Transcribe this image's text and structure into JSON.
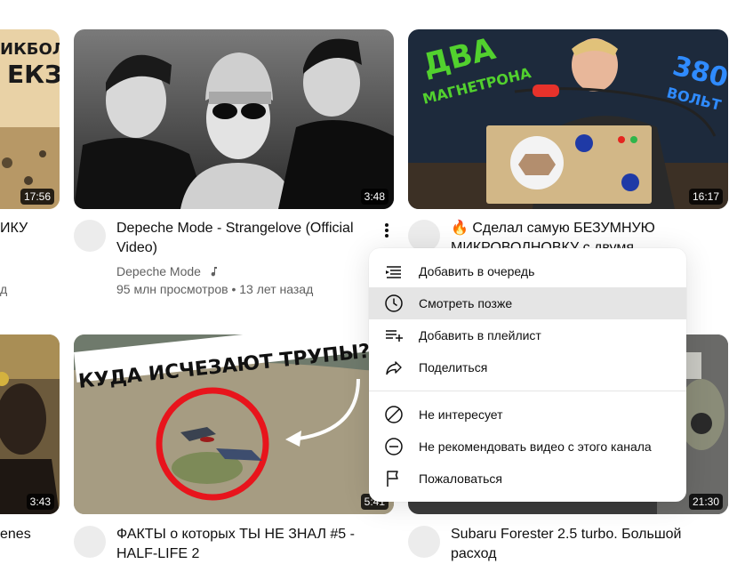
{
  "row1": {
    "left_partial": {
      "thumb_text": "ИКБОЛА\nЕКЗА",
      "duration": "17:56",
      "title": "ИКУ",
      "meta_fragment": "д"
    },
    "video_center": {
      "duration": "3:48",
      "title": "Depeche Mode - Strangelove (Official Video)",
      "channel": "Depeche Mode",
      "channel_badge_icon": "music-note-icon",
      "views": "95 млн просмотров",
      "age": "13 лет назад"
    },
    "video_right": {
      "thumb_text_left": "ДВА",
      "thumb_text_left2": "МАГНЕТРОНА",
      "thumb_text_right": "380",
      "thumb_text_right2": "ВОЛЬТ",
      "duration": "16:17",
      "title": "🔥 Сделал самую БЕЗУМНУЮ МИКРОВОЛНОВКУ с двумя"
    }
  },
  "row2": {
    "left_partial": {
      "duration": "3:43",
      "title": "enes"
    },
    "video_center": {
      "thumb_text": "КУДА ИСЧЕЗАЮТ ТРУПЫ?",
      "duration": "5:41",
      "title": "ФАКТЫ о которых ТЫ НЕ ЗНАЛ #5 - HALF-LIFE 2"
    },
    "video_right": {
      "duration": "21:30",
      "title": "Subaru Forester 2.5 turbo. Большой расход"
    }
  },
  "context_menu": {
    "group1": [
      {
        "label": "Добавить в очередь",
        "icon": "add-to-queue-icon"
      },
      {
        "label": "Смотреть позже",
        "icon": "clock-icon",
        "hovered": true
      },
      {
        "label": "Добавить в плейлист",
        "icon": "playlist-add-icon"
      },
      {
        "label": "Поделиться",
        "icon": "share-icon"
      }
    ],
    "group2": [
      {
        "label": "Не интересует",
        "icon": "not-interested-icon"
      },
      {
        "label": "Не рекомендовать видео с этого канала",
        "icon": "remove-circle-icon"
      },
      {
        "label": "Пожаловаться",
        "icon": "flag-icon"
      }
    ]
  },
  "colors": {
    "menu_hover": "#e5e5e5",
    "meta_text": "#606060",
    "red_circle": "#e8141c"
  }
}
